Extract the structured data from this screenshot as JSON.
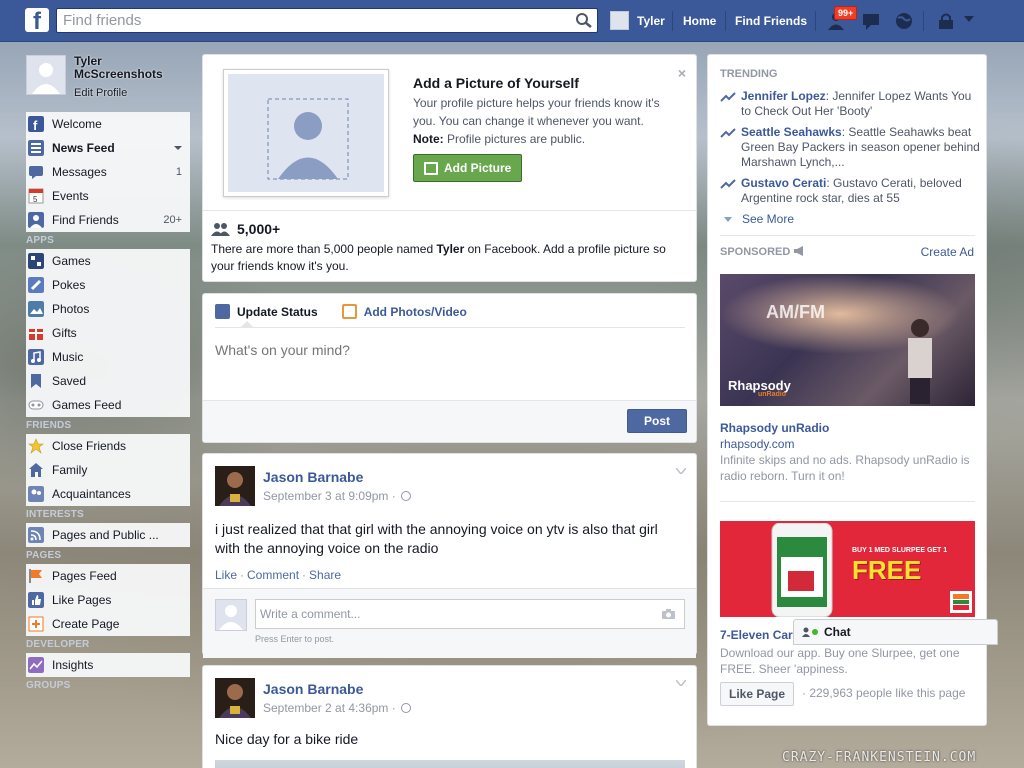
{
  "topbar": {
    "search_placeholder": "Find friends",
    "user_name": "Tyler",
    "home_label": "Home",
    "find_friends_label": "Find Friends",
    "notif_badge": "99+"
  },
  "profile": {
    "name": "Tyler McScreenshots",
    "edit_label": "Edit Profile"
  },
  "leftnav": {
    "main": [
      {
        "label": "Welcome",
        "count": "",
        "icon": "facebook-icon",
        "color": "#3b5998"
      },
      {
        "label": "News Feed",
        "count": "",
        "icon": "news-feed-icon",
        "color": "#4e69a2"
      },
      {
        "label": "Messages",
        "count": "1",
        "icon": "messages-icon",
        "color": "#4e69a2"
      },
      {
        "label": "Events",
        "count": "",
        "icon": "calendar-icon",
        "color": "#ffffff"
      },
      {
        "label": "Find Friends",
        "count": "20+",
        "icon": "find-friends-icon",
        "color": "#4e69a2"
      }
    ],
    "apps_title": "APPS",
    "apps": [
      {
        "label": "Games",
        "icon": "games-icon",
        "color": "#2d4679"
      },
      {
        "label": "Pokes",
        "icon": "pokes-icon",
        "color": "#5b7bc0"
      },
      {
        "label": "Photos",
        "icon": "photos-icon",
        "color": "#4e7ca8"
      },
      {
        "label": "Gifts",
        "icon": "gift-icon",
        "color": "#d8392b"
      },
      {
        "label": "Music",
        "icon": "music-icon",
        "color": "#4e69a2"
      },
      {
        "label": "Saved",
        "icon": "bookmark-icon",
        "color": "#4e69a2"
      },
      {
        "label": "Games Feed",
        "icon": "controller-icon",
        "color": "#8e94a0"
      }
    ],
    "friends_title": "FRIENDS",
    "friends": [
      {
        "label": "Close Friends",
        "icon": "star-icon",
        "color": "#f3c530"
      },
      {
        "label": "Family",
        "icon": "family-icon",
        "color": "#4e69a2"
      },
      {
        "label": "Acquaintances",
        "icon": "acquaintances-icon",
        "color": "#6d84b4"
      }
    ],
    "interests_title": "INTERESTS",
    "interests": [
      {
        "label": "Pages and Public ...",
        "icon": "rss-icon",
        "color": "#6d84b4"
      }
    ],
    "pages_title": "PAGES",
    "pages": [
      {
        "label": "Pages Feed",
        "icon": "flag-icon",
        "color": "#f07a27"
      },
      {
        "label": "Like Pages",
        "icon": "thumbs-up-icon",
        "color": "#4e69a2"
      },
      {
        "label": "Create Page",
        "icon": "create-page-icon",
        "color": "#f07a27"
      }
    ],
    "developer_title": "DEVELOPER",
    "developer": [
      {
        "label": "Insights",
        "icon": "insights-icon",
        "color": "#8e6cc0"
      }
    ],
    "groups_title": "GROUPS"
  },
  "addpicture": {
    "title": "Add a Picture of Yourself",
    "desc": "Your profile picture helps your friends know it's you. You can change it whenever you want.",
    "note_label": "Note:",
    "note_text": " Profile pictures are public.",
    "button": "Add Picture",
    "close": "×",
    "count": "5,000+",
    "count_desc_a": "There are more than 5,000 people named ",
    "count_desc_name": "Tyler",
    "count_desc_b": " on Facebook. Add a profile picture so your friends know it's you."
  },
  "composer": {
    "tab_status": "Update Status",
    "tab_photos": "Add Photos/Video",
    "placeholder": "What's on your mind?",
    "post_button": "Post"
  },
  "posts": [
    {
      "author": "Jason Barnabe",
      "date": "September 3 at 9:09pm · ",
      "text": "i just realized that that girl with the annoying voice on ytv is also that girl with the annoying voice on the radio",
      "like": "Like",
      "comment": "Comment",
      "share": "Share",
      "comment_placeholder": "Write a comment...",
      "comment_hint": "Press Enter to post."
    },
    {
      "author": "Jason Barnabe",
      "date": "September 2 at 4:36pm · ",
      "text": "Nice day for a bike ride"
    }
  ],
  "trending": {
    "title": "TRENDING",
    "items": [
      {
        "name": "Jennifer Lopez",
        "text": ": Jennifer Lopez Wants You to Check Out Her 'Booty'"
      },
      {
        "name": "Seattle Seahawks",
        "text": ": Seattle Seahawks beat Green Bay Packers in season opener behind Marshawn Lynch,..."
      },
      {
        "name": "Gustavo Cerati",
        "text": ": Gustavo Cerati, beloved Argentine rock star, dies at 55"
      }
    ],
    "see_more": "See More"
  },
  "sponsored": {
    "title": "SPONSORED",
    "create_ad": "Create Ad",
    "ads": [
      {
        "image_text": "AM/FM",
        "brand": "Rhapsody",
        "brand_sub": "unRadio",
        "title": "Rhapsody unRadio",
        "url": "rhapsody.com",
        "desc": "Infinite skips and no ads. Rhapsody unRadio is radio reborn. Turn it on!"
      },
      {
        "image_small": "BUY 1 MED SLURPEE GET 1",
        "image_big": "FREE",
        "title": "7-Eleven Car",
        "desc": "Download our app. Buy one Slurpee, get one FREE. Sheer 'appiness.",
        "like_button": "Like Page",
        "likes": "· 229,963 people like this page"
      }
    ]
  },
  "chat": {
    "label": "Chat"
  },
  "watermark": "CRAZY-FRANKENSTEIN.COM"
}
